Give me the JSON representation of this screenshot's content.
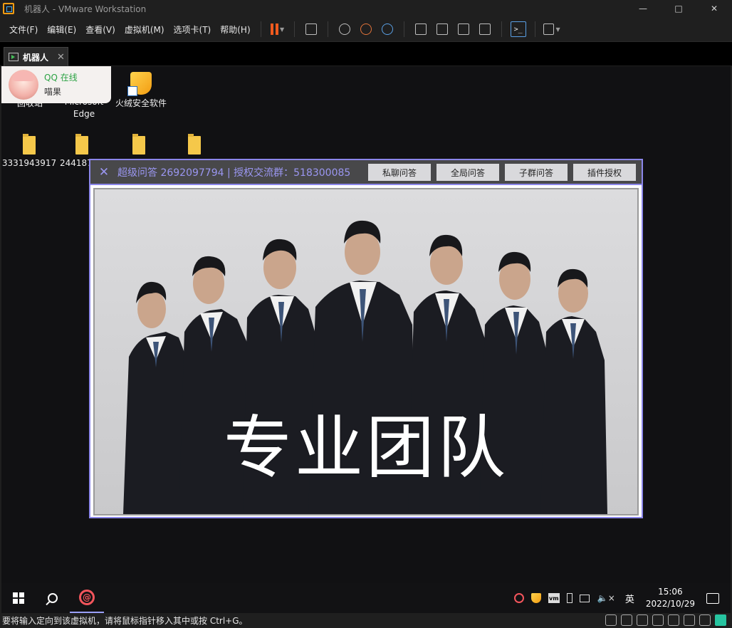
{
  "window": {
    "title": "机器人 - VMware Workstation",
    "minimize": "—",
    "maximize": "□",
    "close": "✕"
  },
  "menu": [
    "文件(F)",
    "编辑(E)",
    "查看(V)",
    "虚拟机(M)",
    "选项卡(T)",
    "帮助(H)"
  ],
  "toolbar": {
    "pause_color": "#f05a1e",
    "console_label": ">_"
  },
  "tab": {
    "label": "机器人",
    "close": "✕"
  },
  "qq_toast": {
    "status": "QQ 在线",
    "nickname": "喵果"
  },
  "desktop_icons": {
    "recycle_bin": "回收站",
    "edge_line1": "Microsoft",
    "edge_line2": "Edge",
    "huorong": "火绒安全软件",
    "folder1": "3331943917",
    "folder2": "2441873",
    "folder3": "",
    "folder4": ""
  },
  "popup": {
    "close": "✕",
    "title": "超级问答  2692097794  |  授权交流群：518300085",
    "buttons": [
      "私聊问答",
      "全局问答",
      "子群问答",
      "插件授权"
    ],
    "banner": "专业团队",
    "accent": "#8b86ea"
  },
  "taskbar": {
    "ime": "英",
    "time": "15:06",
    "date": "2022/10/29",
    "volume": "🔈×",
    "vm_tray": "vm"
  },
  "statusbar": {
    "text": "要将输入定向到该虚拟机，请将鼠标指针移入其中或按 Ctrl+G。"
  }
}
